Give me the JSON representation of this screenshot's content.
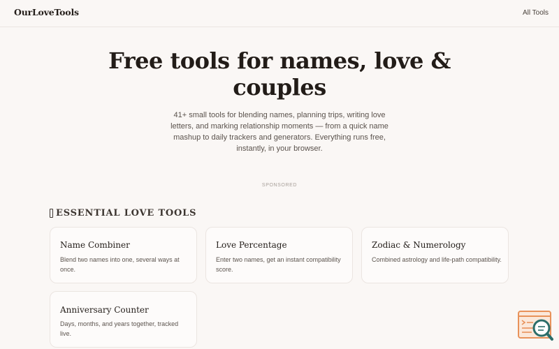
{
  "header": {
    "logo": "OurLoveTools",
    "nav_all_tools": "All Tools"
  },
  "hero": {
    "title": "Free tools for names, love & couples",
    "subtitle": "41+ small tools for blending names, planning trips, writing love letters, and marking relationship moments — from a quick name mashup to daily trackers and generators. Everything runs free, instantly, in your browser."
  },
  "ad": {
    "label": "SPONSORED"
  },
  "section": {
    "heading": "ESSENTIAL LOVE TOOLS",
    "heading_icon": "bookmark-icon"
  },
  "cards": [
    {
      "title": "Name Combiner",
      "desc": "Blend two names into one, several ways at once."
    },
    {
      "title": "Love Percentage",
      "desc": "Enter two names, get an instant compatibility score."
    },
    {
      "title": "Zodiac & Numerology",
      "desc": "Combined astrology and life-path compatibility."
    },
    {
      "title": "Anniversary Counter",
      "desc": "Days, months, and years together, tracked live."
    }
  ],
  "widget": {
    "icon": "search-document-icon",
    "accent": "#e8925a",
    "teal": "#2c6e6a"
  }
}
